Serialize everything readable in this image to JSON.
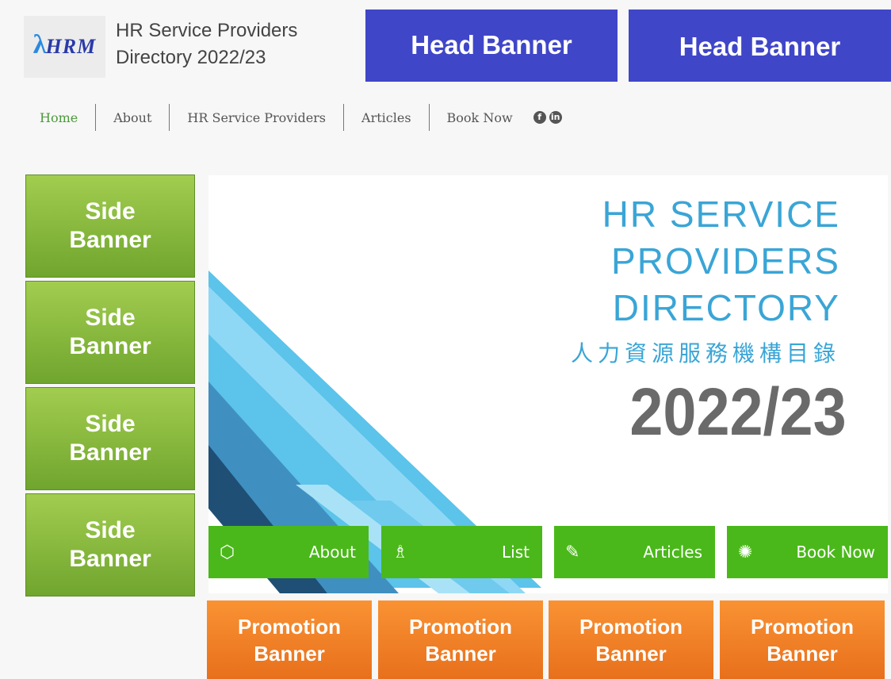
{
  "header": {
    "logo_text": "HRM",
    "title_line1": "HR Service Providers",
    "title_line2": "Directory 2022/23",
    "head_banners": [
      "Head Banner",
      "Head Banner"
    ]
  },
  "nav": {
    "items": [
      "Home",
      "About",
      "HR Service Providers",
      "Articles",
      "Book Now"
    ],
    "active": "Home",
    "social": [
      "facebook-icon",
      "linkedin-icon"
    ]
  },
  "side_banners": [
    {
      "line1": "Side",
      "line2": "Banner"
    },
    {
      "line1": "Side",
      "line2": "Banner"
    },
    {
      "line1": "Side",
      "line2": "Banner"
    },
    {
      "line1": "Side",
      "line2": "Banner"
    }
  ],
  "hero": {
    "title_lines": [
      "HR SERVICE",
      "PROVIDERS",
      "DIRECTORY"
    ],
    "chinese_title": "人力資源服務機構目錄",
    "year": "2022/23"
  },
  "quick_links": [
    {
      "label": "About",
      "icon": "box-icon"
    },
    {
      "label": "List",
      "icon": "chess-piece-icon"
    },
    {
      "label": "Articles",
      "icon": "pencil-icon"
    },
    {
      "label": "Book Now",
      "icon": "lightbulb-icon"
    }
  ],
  "promo_banners": [
    {
      "line1": "Promotion",
      "line2": "Banner"
    },
    {
      "line1": "Promotion",
      "line2": "Banner"
    },
    {
      "line1": "Promotion",
      "line2": "Banner"
    },
    {
      "line1": "Promotion",
      "line2": "Banner"
    }
  ],
  "colors": {
    "head_banner": "#4046c8",
    "side_banner": "#8bbd3e",
    "quick_button": "#4ab81a",
    "promo_banner": "#f28226",
    "hero_title": "#3aa5d6",
    "nav_active": "#4a9a3a"
  }
}
